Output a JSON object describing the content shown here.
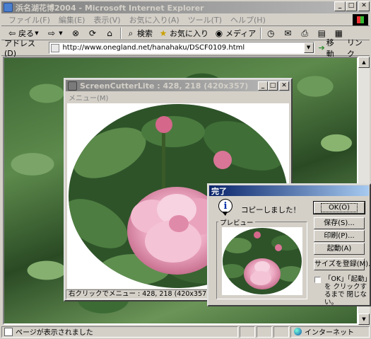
{
  "ie": {
    "title": "浜名湖花博2004 - Microsoft Internet Explorer",
    "menu": [
      "ファイル(F)",
      "編集(E)",
      "表示(V)",
      "お気に入り(A)",
      "ツール(T)",
      "ヘルプ(H)"
    ],
    "toolbar": {
      "back": "戻る",
      "search": "検索",
      "favorites": "お気に入り",
      "media": "メディア"
    },
    "address": {
      "label": "アドレス(D)",
      "url": "http://www.onegland.net/hanahaku/DSCF0109.html",
      "go": "移動",
      "links": "リンク"
    },
    "status": {
      "text": "ページが表示されました",
      "zone": "インターネット"
    }
  },
  "scl": {
    "title": "ScreenCutterLite : 428, 218 (420x357)",
    "menu": "メニュー(M)",
    "status": "右クリックでメニュー : 428, 218 (420x357)"
  },
  "dialog": {
    "title": "完了",
    "message": "コピーしました！",
    "preview_label": "プレビュー",
    "buttons": {
      "ok": "OK(O)",
      "save": "保存(S)...",
      "print": "印刷(P)...",
      "launch": "起動(A)",
      "register_size": "サイズを登録(M)..."
    },
    "checkbox": {
      "label": "「OK」「起動」を クリックするまで 閉じない。",
      "checked": false
    }
  },
  "colors": {
    "dialog_title_active": "#0a246a",
    "inactive_title": "#808080",
    "rose": "#e79ab4",
    "leaf": "#3d6634"
  }
}
